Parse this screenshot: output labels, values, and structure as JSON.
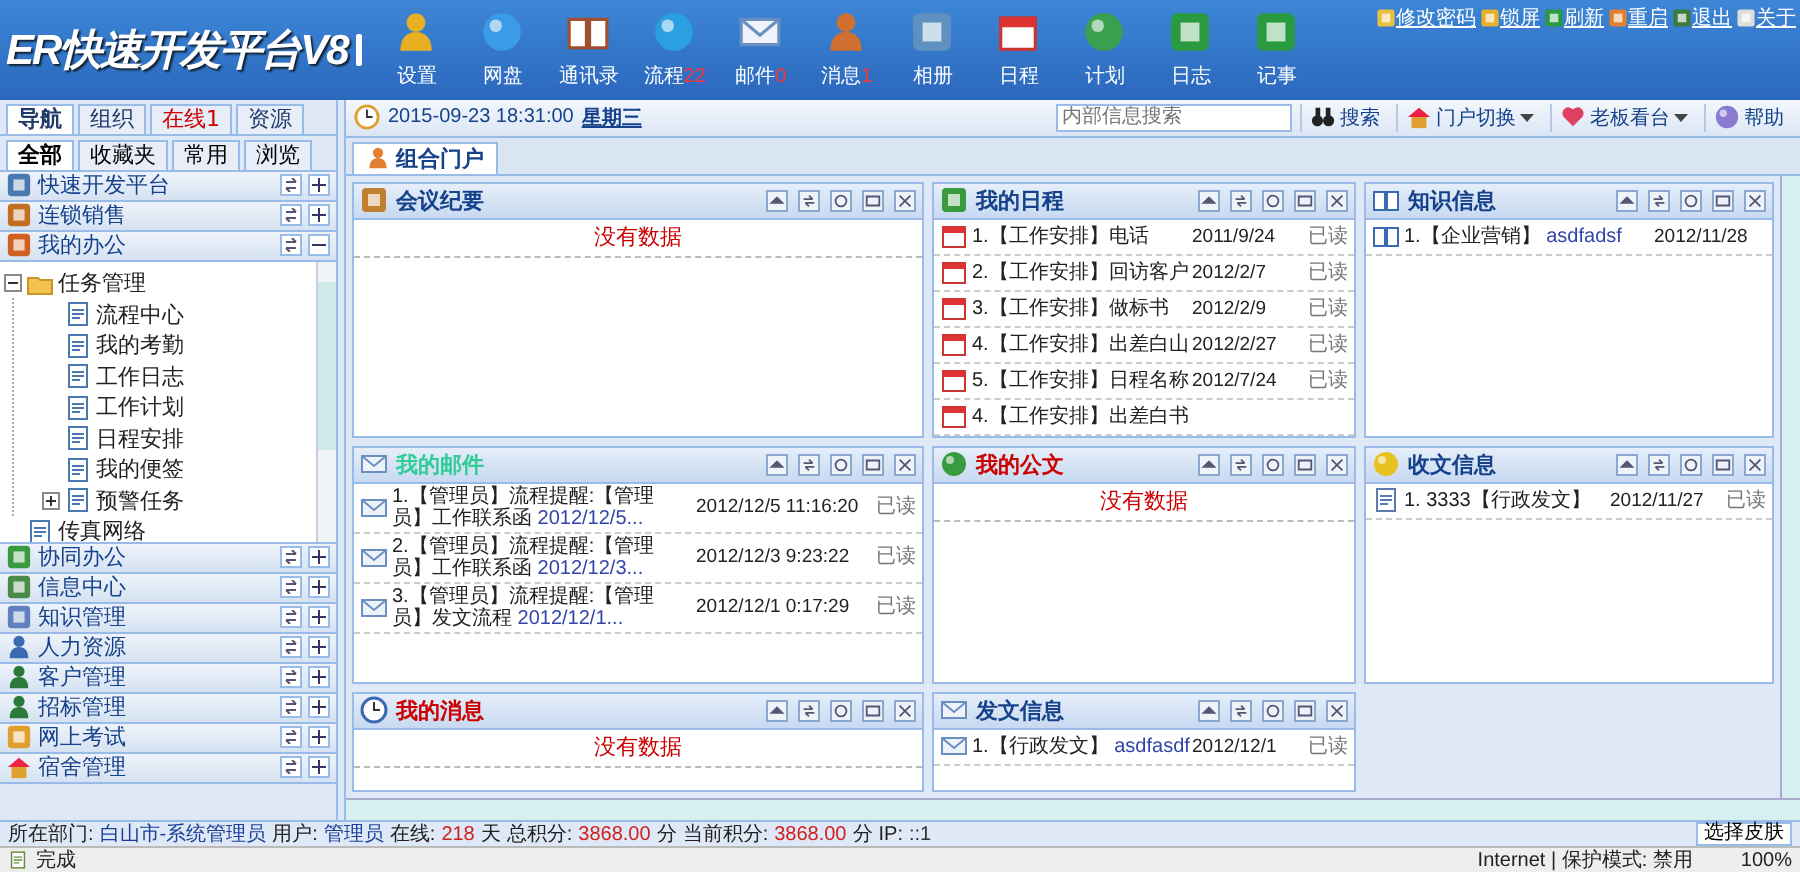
{
  "header": {
    "logo": "ER快速开发平台V8",
    "nav": [
      {
        "label": "设置"
      },
      {
        "label": "网盘"
      },
      {
        "label": "通讯录"
      },
      {
        "label": "流程",
        "badge": "22"
      },
      {
        "label": "邮件",
        "badge": "0"
      },
      {
        "label": "消息",
        "badge": "1"
      },
      {
        "label": "相册"
      },
      {
        "label": "日程"
      },
      {
        "label": "计划"
      },
      {
        "label": "日志"
      },
      {
        "label": "记事"
      }
    ],
    "links": [
      "修改密码",
      "锁屏",
      "刷新",
      "重启",
      "退出",
      "关于"
    ]
  },
  "sidebar": {
    "tabs": [
      {
        "label": "导航",
        "selected": true,
        "color": "#1f3a6a"
      },
      {
        "label": "组织",
        "selected": false,
        "color": "#1f3a6a"
      },
      {
        "label": "在线1",
        "selected": false,
        "color": "#cc0000"
      },
      {
        "label": "资源",
        "selected": false,
        "color": "#1f3a6a"
      }
    ],
    "filters": [
      {
        "label": "全部",
        "selected": true
      },
      {
        "label": "收藏夹",
        "selected": false
      },
      {
        "label": "常用",
        "selected": false
      },
      {
        "label": "浏览",
        "selected": false
      }
    ],
    "sections": [
      {
        "label": "快速开发平台",
        "expanded": false
      },
      {
        "label": "连锁销售",
        "expanded": false
      },
      {
        "label": "我的办公",
        "expanded": true,
        "children": [
          {
            "label": "任务管理",
            "expanded": true,
            "children": [
              {
                "label": "流程中心"
              },
              {
                "label": "我的考勤"
              },
              {
                "label": "工作日志"
              },
              {
                "label": "工作计划"
              },
              {
                "label": "日程安排"
              },
              {
                "label": "我的便签"
              },
              {
                "label": "预警任务",
                "expanded": false
              }
            ]
          },
          {
            "label": "传真网络"
          }
        ]
      },
      {
        "label": "协同办公",
        "expanded": false
      },
      {
        "label": "信息中心",
        "expanded": false
      },
      {
        "label": "知识管理",
        "expanded": false
      },
      {
        "label": "人力资源",
        "expanded": false
      },
      {
        "label": "客户管理",
        "expanded": false
      },
      {
        "label": "招标管理",
        "expanded": false
      },
      {
        "label": "网上考试",
        "expanded": false
      },
      {
        "label": "宿舍管理",
        "expanded": false
      }
    ]
  },
  "toolbar": {
    "datetime": "2015-09-23 18:31:00",
    "weekday": "星期三",
    "search": {
      "placeholder": "内部信息搜索"
    },
    "buttons": [
      {
        "label": "搜索",
        "kind": "plain"
      },
      {
        "label": "门户切换",
        "kind": "menu"
      },
      {
        "label": "老板看台",
        "kind": "menu"
      },
      {
        "label": "帮助",
        "kind": "plain"
      }
    ]
  },
  "tabs": [
    {
      "label": "组合门户",
      "selected": true
    }
  ],
  "panels": [
    {
      "title": "会议纪要",
      "color": "#15428b",
      "kind": "empty",
      "message": "没有数据"
    },
    {
      "title": "我的日程",
      "color": "#15428b",
      "kind": "list",
      "rows": [
        {
          "text": "1.【工作安排】电话",
          "date": "2011/9/24",
          "status": "已读"
        },
        {
          "text": "2.【工作安排】回访客户",
          "date": "2012/2/7",
          "status": "已读"
        },
        {
          "text": "3.【工作安排】做标书",
          "date": "2012/2/9",
          "status": "已读"
        },
        {
          "text": "4.【工作安排】出差白山",
          "date": "2012/2/27",
          "status": "已读"
        },
        {
          "text": "5.【工作安排】日程名称",
          "date": "2012/7/24",
          "status": "已读"
        },
        {
          "text": "4.【工作安排】出差白书"
        }
      ]
    },
    {
      "title": "知识信息",
      "color": "#15428b",
      "kind": "list",
      "rows": [
        {
          "text": "1.【企业营销】",
          "sub": "asdfadsf",
          "date": "2012/11/28"
        }
      ]
    },
    {
      "title": "我的邮件",
      "color": "#33cc99",
      "kind": "list",
      "rows": [
        {
          "text": "1.【管理员】流程提醒:【管理员】工作联系函",
          "sub": "2012/12/5...",
          "date": "2012/12/5 11:16:20",
          "status": "已读"
        },
        {
          "text": "2.【管理员】流程提醒:【管理员】工作联系函",
          "sub": "2012/12/3...",
          "date": "2012/12/3 9:23:22",
          "status": "已读"
        },
        {
          "text": "3.【管理员】流程提醒:【管理员】发文流程",
          "sub": "2012/12/1...",
          "date": "2012/12/1 0:17:29",
          "status": "已读"
        }
      ]
    },
    {
      "title": "我的公文",
      "color": "#cc0000",
      "kind": "empty",
      "message": "没有数据"
    },
    {
      "title": "收文信息",
      "color": "#15428b",
      "kind": "list",
      "rows": [
        {
          "text": "1. 3333【行政发文】",
          "date": "2012/11/27",
          "status": "已读"
        }
      ]
    },
    {
      "title": "我的消息",
      "color": "#cc0000",
      "kind": "empty",
      "message": "没有数据"
    },
    {
      "title": "发文信息",
      "color": "#15428b",
      "kind": "list",
      "rows": [
        {
          "text": "1.【行政发文】",
          "sub": "asdfasdf",
          "date": "2012/12/1",
          "status": "已读"
        }
      ]
    }
  ],
  "status_bar": {
    "items": [
      {
        "label": "所在部门:",
        "value": "白山市-系统管理员",
        "kind": "name"
      },
      {
        "label": "用户:",
        "value": "管理员",
        "kind": "name"
      },
      {
        "label": "在线:",
        "value": "218",
        "unit": "天",
        "kind": "number"
      },
      {
        "label": "总积分:",
        "value": "3868.00",
        "unit": "分",
        "kind": "number"
      },
      {
        "label": "当前积分:",
        "value": "3868.00",
        "unit": "分",
        "kind": "number"
      },
      {
        "label": "IP:",
        "value": "::1",
        "kind": "plain"
      }
    ],
    "skin": "选择皮肤"
  },
  "browser_status": {
    "state": "完成",
    "zone": "Internet | 保护模式: 禁用",
    "zoom": "100%"
  }
}
